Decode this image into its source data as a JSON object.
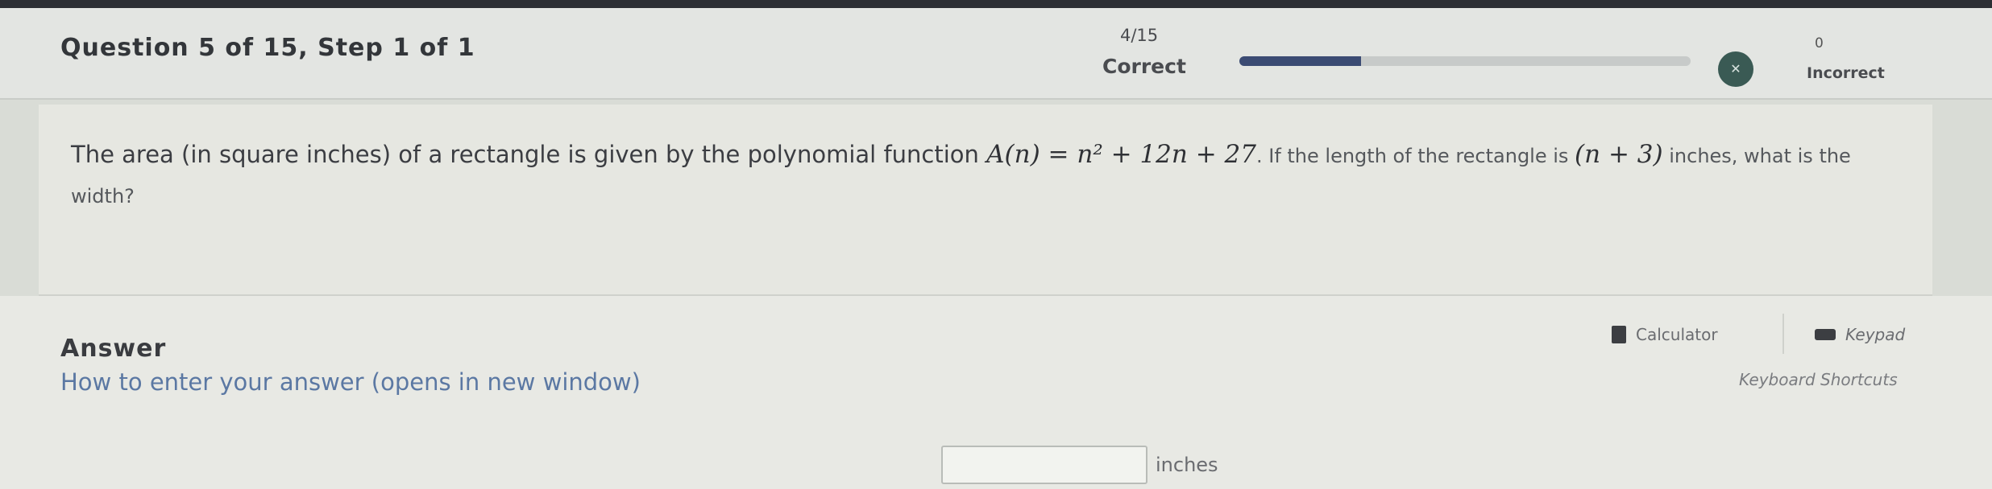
{
  "header": {
    "question_title": "Question 5 of 15,  Step 1 of 1",
    "score_fraction": "4/15",
    "correct_label": "Correct",
    "progress_fraction": 0.27,
    "incorrect_count": "0",
    "incorrect_label": "Incorrect"
  },
  "question": {
    "text_before": "The area (in square inches) of a rectangle is given by the polynomial function ",
    "function": "A(n) = n² + 12n + 27",
    "text_middle": ". If the length of the rectangle is ",
    "length_expr": "(n + 3)",
    "text_after": " inches, what is the width?"
  },
  "answer": {
    "heading": "Answer",
    "how_to_link": "How to enter your answer (opens in new window)",
    "calculator_label": "Calculator",
    "keypad_label": "Keypad",
    "shortcuts_label": "Keyboard Shortcuts",
    "input_value": "",
    "unit_label": "inches"
  },
  "colors": {
    "progress_fill": "#3b4b73",
    "link": "#5b78a3"
  }
}
